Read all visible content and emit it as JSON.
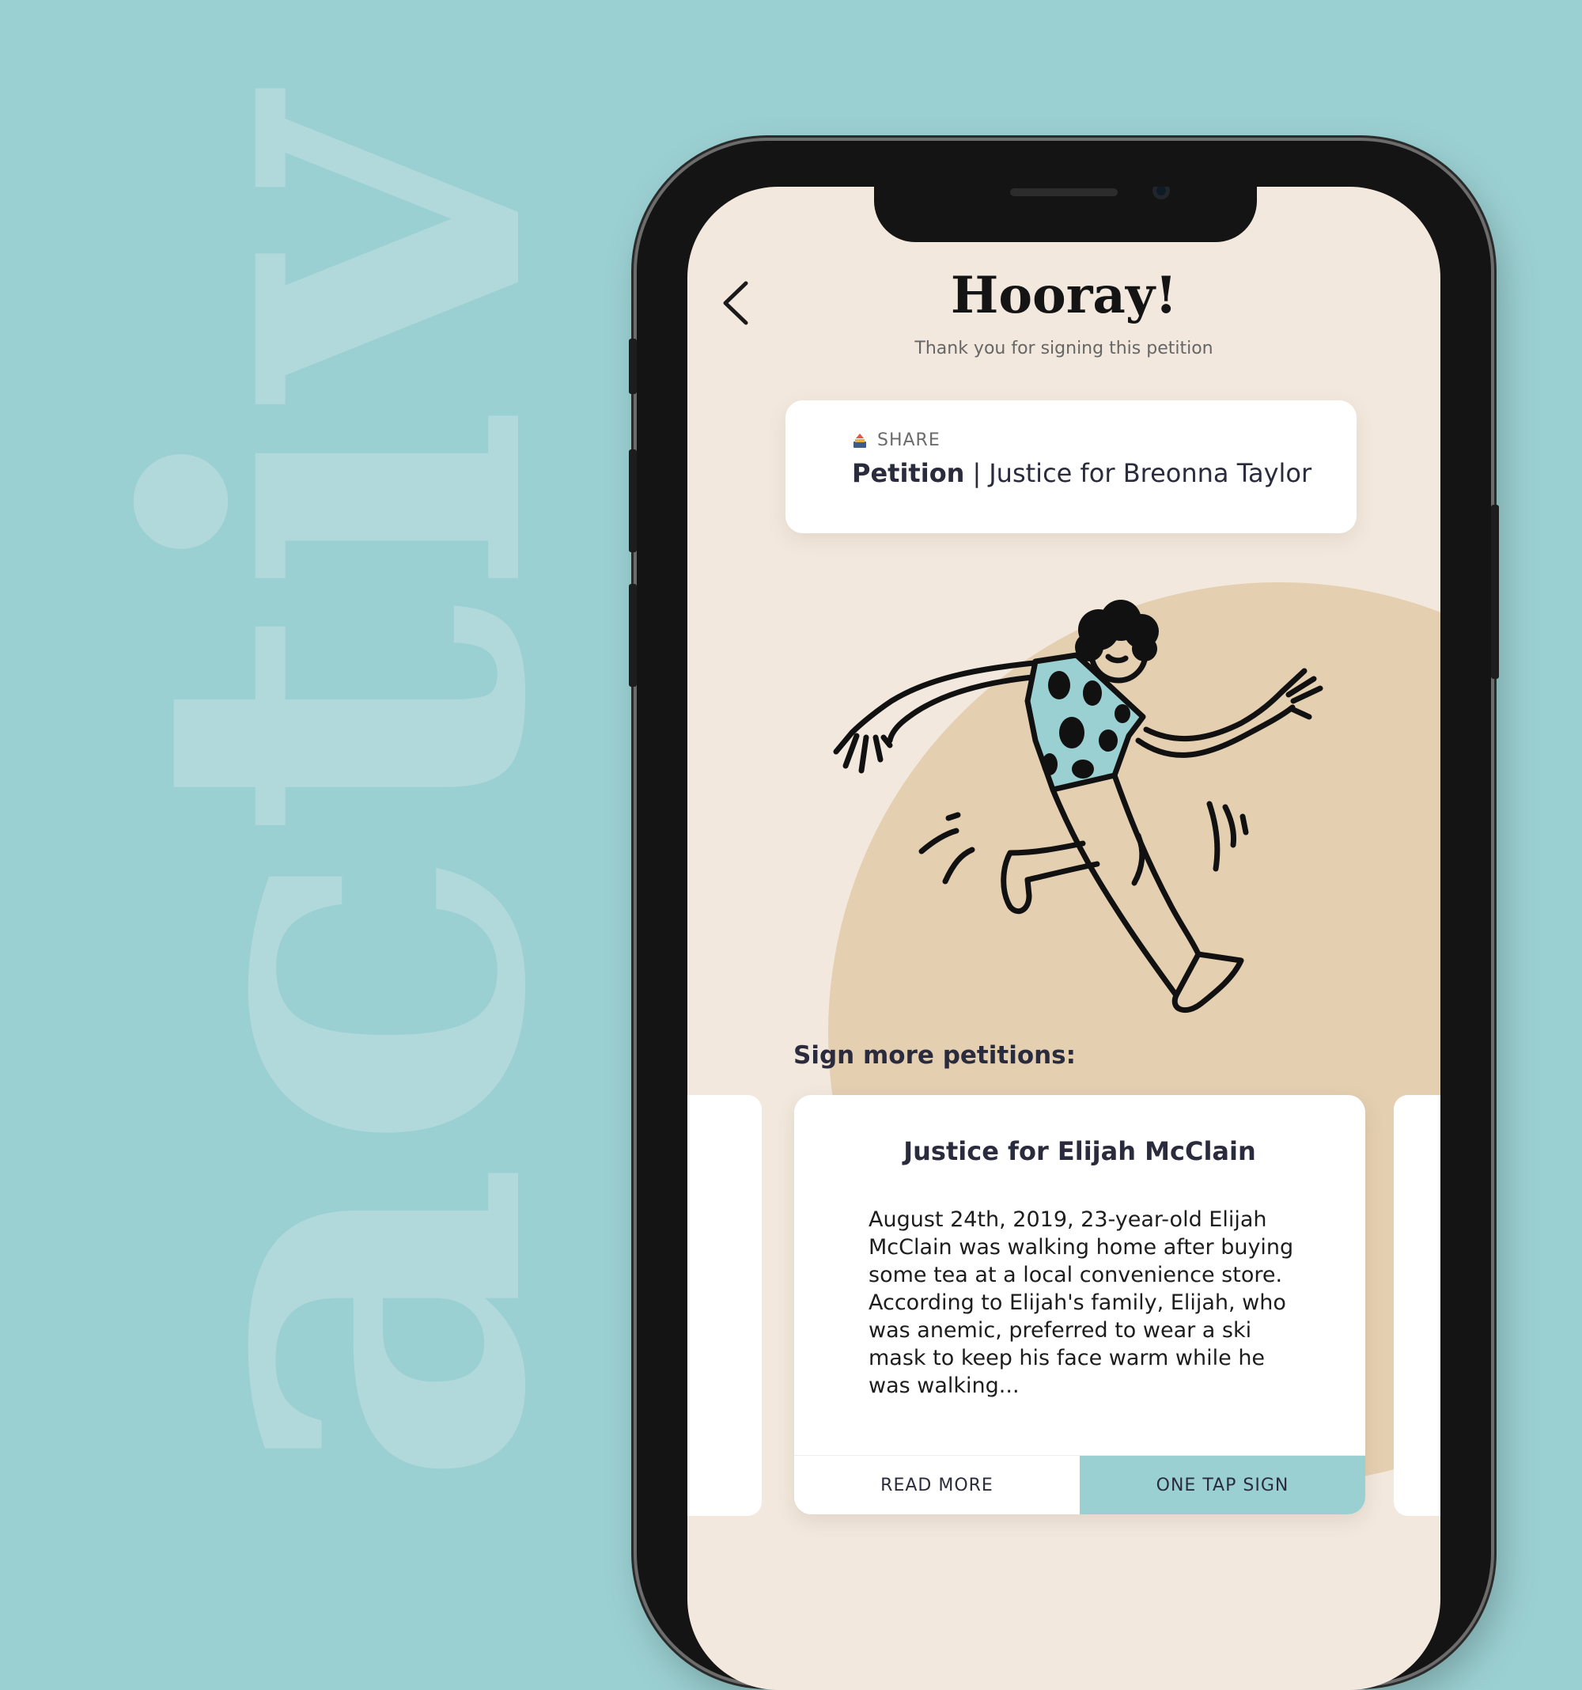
{
  "brand": {
    "word": "activ"
  },
  "header": {
    "title": "Hooray!",
    "subtitle": "Thank you for signing this petition"
  },
  "share_card": {
    "share_label": "SHARE",
    "petition_label": "Petition",
    "separator": "|",
    "petition_name": "Justice for Breonna Taylor"
  },
  "more": {
    "section_label": "Sign more petitions:",
    "cards": [
      {
        "title": "Justice for Elijah McClain",
        "body": "August 24th, 2019, 23-year-old Elijah McClain was walking home after buying some tea at a local convenience store. According to Elijah's family, Elijah, who was anemic, preferred to wear a ski mask to keep his face warm while he was walking...",
        "read_more_label": "READ MORE",
        "sign_label": "ONE TAP SIGN"
      }
    ]
  },
  "colors": {
    "background": "#9bd0d2",
    "screen": "#f2e8dd",
    "sun": "#e4cfb1",
    "accent": "#9bd0d2",
    "text_dark": "#2a2b3c"
  },
  "icons": {
    "back": "chevron-left-icon",
    "share": "share-icon"
  }
}
